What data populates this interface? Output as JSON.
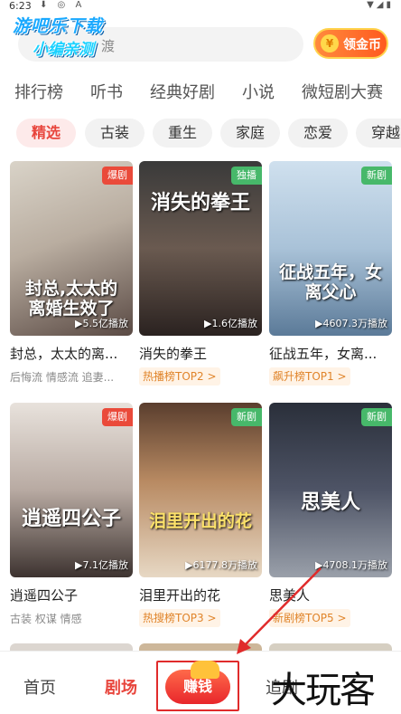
{
  "status": {
    "time": "6:23"
  },
  "watermark": {
    "line1": "游吧乐下载",
    "line2": "小编亲测",
    "corner": "大玩客"
  },
  "search": {
    "placeholder": "渡"
  },
  "coin_button": {
    "icon": "¥",
    "label": "领金币"
  },
  "categories": [
    "排行榜",
    "听书",
    "经典好剧",
    "小说",
    "微短剧大赛"
  ],
  "chips": [
    "精选",
    "古装",
    "重生",
    "家庭",
    "恋爱",
    "穿越"
  ],
  "cards": [
    {
      "poster_title": "封总,太太的离婚生效了",
      "badge": "爆剧",
      "plays": "▶5.5亿播放",
      "title": "封总，太太的离...",
      "tags": "后悔流 情感流 追妻..."
    },
    {
      "poster_title": "消失的拳王",
      "badge": "独播",
      "plays": "▶1.6亿播放",
      "title": "消失的拳王",
      "rank": "热播榜TOP2 >"
    },
    {
      "poster_title": "征战五年，女离父心",
      "badge": "新剧",
      "plays": "▶4607.3万播放",
      "title": "征战五年，女离...",
      "rank": "飙升榜TOP1 >"
    },
    {
      "poster_title": "逍遥四公子",
      "badge": "爆剧",
      "plays": "▶7.1亿播放",
      "title": "逍遥四公子",
      "tags": "古装 权谋 情感"
    },
    {
      "poster_title": "泪里开出的花",
      "badge": "新剧",
      "plays": "▶6177.8万播放",
      "title": "泪里开出的花",
      "rank": "热搜榜TOP3 >"
    },
    {
      "poster_title": "思美人",
      "badge": "新剧",
      "plays": "▶4708.1万播放",
      "title": "思美人",
      "rank": "新剧榜TOP5 >"
    }
  ],
  "nav": {
    "home": "首页",
    "theater": "剧场",
    "earn": "赚钱",
    "follow": "追剧"
  }
}
